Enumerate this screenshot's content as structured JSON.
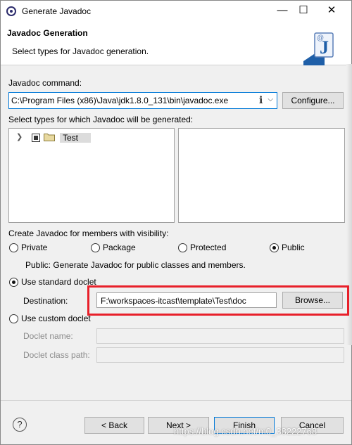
{
  "window": {
    "title": "Generate Javadoc"
  },
  "banner": {
    "title": "Javadoc Generation",
    "description": "Select types for Javadoc generation."
  },
  "javadoc_command": {
    "label": "Javadoc command:",
    "value": "C:\\Program Files (x86)\\Java\\jdk1.8.0_131\\bin\\javadoc.exe",
    "configure_label": "Configure..."
  },
  "types": {
    "label": "Select types for which Javadoc will be generated:",
    "tree": [
      {
        "label": "Test",
        "checked": "partial"
      }
    ]
  },
  "visibility": {
    "label": "Create Javadoc for members with visibility:",
    "options": [
      "Private",
      "Package",
      "Protected",
      "Public"
    ],
    "selected": "Public",
    "description": "Public: Generate Javadoc for public classes and members."
  },
  "standard_doclet": {
    "label": "Use standard doclet",
    "destination_label": "Destination:",
    "destination_value": "F:\\workspaces-itcast\\template\\Test\\doc",
    "browse_label": "Browse..."
  },
  "custom_doclet": {
    "label": "Use custom doclet",
    "doclet_name_label": "Doclet name:",
    "doclet_classpath_label": "Doclet class path:"
  },
  "footer": {
    "back_label": "< Back",
    "next_label": "Next >",
    "finish_label": "Finish",
    "cancel_label": "Cancel"
  },
  "watermark": "https://blog.csdn.net/m0_38222768",
  "colors": {
    "accent": "#0078d7",
    "highlight": "#e8202a"
  }
}
